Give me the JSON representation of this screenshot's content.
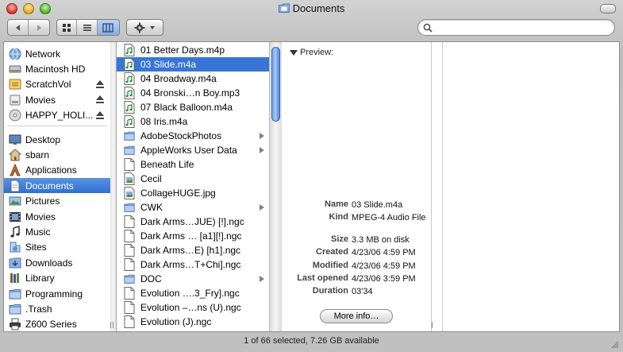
{
  "window": {
    "title": "Documents"
  },
  "toolbar": {
    "search_placeholder": "",
    "view_modes": [
      "icon",
      "list",
      "column"
    ],
    "active_view": "column"
  },
  "sidebar": {
    "devices": [
      {
        "label": "Network",
        "icon": "network-icon",
        "eject": false
      },
      {
        "label": "Macintosh HD",
        "icon": "harddisk-icon",
        "eject": false
      },
      {
        "label": "ScratchVol",
        "icon": "volume-icon",
        "eject": true
      },
      {
        "label": "Movies",
        "icon": "disk-icon",
        "eject": true
      },
      {
        "label": "HAPPY_HOLI...",
        "icon": "cd-icon",
        "eject": true
      }
    ],
    "places": [
      {
        "label": "Desktop",
        "icon": "desktop-icon"
      },
      {
        "label": "sbarn",
        "icon": "home-icon"
      },
      {
        "label": "Applications",
        "icon": "applications-icon"
      },
      {
        "label": "Documents",
        "icon": "documents-icon",
        "selected": true
      },
      {
        "label": "Pictures",
        "icon": "pictures-icon"
      },
      {
        "label": "Movies",
        "icon": "movies-icon"
      },
      {
        "label": "Music",
        "icon": "music-icon"
      },
      {
        "label": "Sites",
        "icon": "sites-icon"
      },
      {
        "label": "Downloads",
        "icon": "downloads-icon"
      },
      {
        "label": "Library",
        "icon": "library-icon"
      },
      {
        "label": "Programming",
        "icon": "folder-icon"
      },
      {
        "label": ".Trash",
        "icon": "folder-icon"
      },
      {
        "label": "Z600 Series",
        "icon": "printer-icon"
      }
    ]
  },
  "files": [
    {
      "name": "01 Better Days.m4p",
      "icon": "audio-file-icon",
      "folder": false
    },
    {
      "name": "03 Slide.m4a",
      "icon": "audio-file-icon",
      "folder": false,
      "selected": true
    },
    {
      "name": "04 Broadway.m4a",
      "icon": "audio-file-icon",
      "folder": false
    },
    {
      "name": "04 Bronski…n Boy.mp3",
      "icon": "audio-file-icon",
      "folder": false
    },
    {
      "name": "07 Black Balloon.m4a",
      "icon": "audio-file-icon",
      "folder": false
    },
    {
      "name": "08 Iris.m4a",
      "icon": "audio-file-icon",
      "folder": false
    },
    {
      "name": "AdobeStockPhotos",
      "icon": "folder-icon",
      "folder": true
    },
    {
      "name": "AppleWorks User Data",
      "icon": "folder-icon",
      "folder": true
    },
    {
      "name": "Beneath Life",
      "icon": "document-icon",
      "folder": false
    },
    {
      "name": "Cecil",
      "icon": "image-file-icon",
      "folder": false
    },
    {
      "name": "CollageHUGE.jpg",
      "icon": "image-file-icon",
      "folder": false
    },
    {
      "name": "CWK",
      "icon": "folder-icon",
      "folder": true
    },
    {
      "name": "Dark Arms…JUE) [!].ngc",
      "icon": "document-icon",
      "folder": false
    },
    {
      "name": "Dark Arms … [a1][!].ngc",
      "icon": "document-icon",
      "folder": false
    },
    {
      "name": "Dark Arms…E) [h1].ngc",
      "icon": "document-icon",
      "folder": false
    },
    {
      "name": "Dark Arms…T+Chi].ngc",
      "icon": "document-icon",
      "folder": false
    },
    {
      "name": "DOC",
      "icon": "folder-icon",
      "folder": true
    },
    {
      "name": "Evolution ….3_Fry].ngc",
      "icon": "document-icon",
      "folder": false
    },
    {
      "name": "Evolution –…ns (U).ngc",
      "icon": "document-icon",
      "folder": false
    },
    {
      "name": "Evolution (J).ngc",
      "icon": "document-icon",
      "folder": false
    }
  ],
  "preview": {
    "label": "Preview:",
    "info": [
      {
        "key": "Name",
        "value": "03 Slide.m4a"
      },
      {
        "key": "Kind",
        "value": "MPEG-4 Audio File"
      },
      {
        "key": "Size",
        "value": "3.3 MB on disk"
      },
      {
        "key": "Created",
        "value": "4/23/06 4:59 PM"
      },
      {
        "key": "Modified",
        "value": "4/23/06 4:59 PM"
      },
      {
        "key": "Last opened",
        "value": "4/23/06 3:59 PM"
      },
      {
        "key": "Duration",
        "value": "03'34"
      }
    ],
    "more_info_label": "More info…"
  },
  "status": {
    "text": "1 of 66 selected, 7.26 GB available"
  },
  "scroll": {
    "position": 0.0,
    "visible_fraction": 0.3
  }
}
